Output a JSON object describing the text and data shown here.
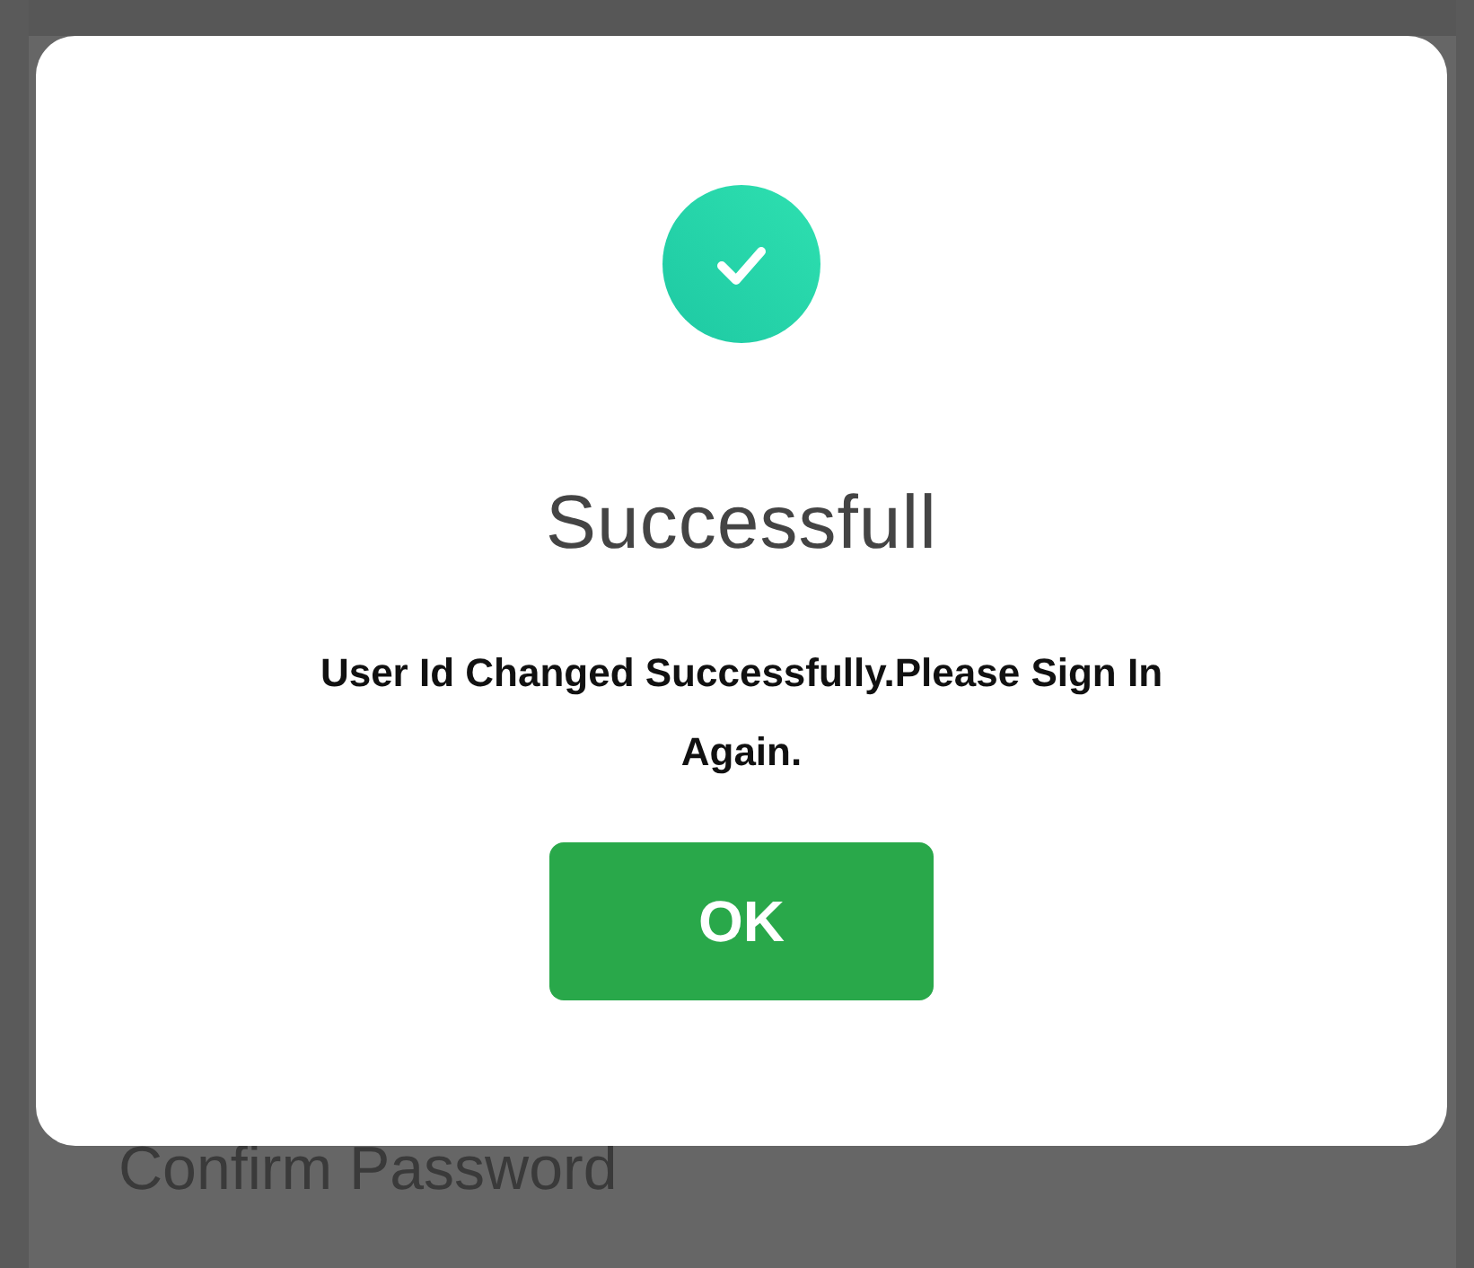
{
  "background_form": {
    "field_label": "Confirm Password"
  },
  "dialog": {
    "title": "Successfull",
    "message": "User Id Changed Successfully.Please Sign In Again.",
    "button": "OK"
  }
}
